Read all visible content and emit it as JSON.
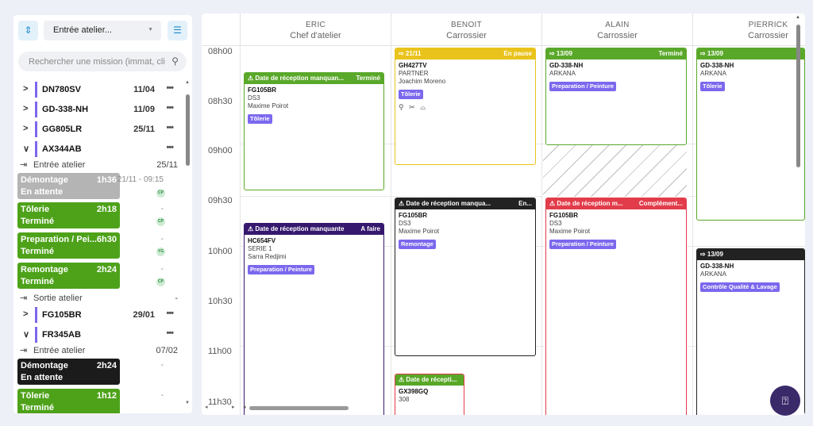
{
  "sidebar": {
    "sort_icon": "sort-arrows-icon",
    "select_value": "Entrée atelier...",
    "filter_icon": "filter-icon",
    "search_placeholder": "Rechercher une mission (immat, cli",
    "vehicles": [
      {
        "plate": "DN780SV",
        "date": "11/04",
        "expanded": false
      },
      {
        "plate": "GD-338-NH",
        "date": "11/09",
        "expanded": false
      },
      {
        "plate": "GG805LR",
        "date": "25/11",
        "expanded": false
      },
      {
        "plate": "AX344AB",
        "date": "",
        "expanded": true,
        "entry_label": "Entrée atelier",
        "entry_value": "25/11",
        "steps": [
          {
            "name": "Démontage",
            "duration": "1h36",
            "status": "En attente",
            "date": "21/11 - 09:15",
            "badge": "CP",
            "color": "grey"
          },
          {
            "name": "Tôlerie",
            "duration": "2h18",
            "status": "Terminé",
            "date": "-",
            "badge": "CP",
            "color": "green"
          },
          {
            "name": "Preparation / Pei...",
            "duration": "6h30",
            "status": "Terminé",
            "date": "-",
            "badge": "YG",
            "color": "green"
          },
          {
            "name": "Remontage",
            "duration": "2h24",
            "status": "Terminé",
            "date": "-",
            "badge": "CP",
            "color": "green"
          }
        ],
        "exit_label": "Sortie atelier",
        "exit_value": "-"
      },
      {
        "plate": "FG105BR",
        "date": "29/01",
        "expanded": false
      },
      {
        "plate": "FR345AB",
        "date": "",
        "expanded": true,
        "entry_label": "Entrée atelier",
        "entry_value": "07/02",
        "steps": [
          {
            "name": "Démontage",
            "duration": "2h24",
            "status": "En attente",
            "date": "-",
            "color": "black"
          },
          {
            "name": "Tôlerie",
            "duration": "1h12",
            "status": "Terminé",
            "date": "-",
            "color": "green"
          }
        ]
      }
    ]
  },
  "planning": {
    "columns": [
      {
        "name": "ERIC",
        "role": "Chef d'atelier"
      },
      {
        "name": "BENOIT",
        "role": "Carrossier"
      },
      {
        "name": "ALAIN",
        "role": "Carrossier"
      },
      {
        "name": "PIERRICK",
        "role": "Carrossier"
      }
    ],
    "times": [
      "08h00",
      "08h30",
      "09h00",
      "09h30",
      "10h00",
      "10h30",
      "11h00",
      "11h30"
    ],
    "cards": {
      "eric1": {
        "header": "⚠ Date de réception manquan...",
        "right": "Terminé",
        "plate": "FG105BR",
        "model": "DS3",
        "client": "Maxime Poirot",
        "tag": "Tôlerie"
      },
      "eric2": {
        "header": "⚠ Date de réception manquante",
        "right": "A faire",
        "plate": "HC654FV",
        "model": "SERIE 1",
        "client": "Sarra Redjimi",
        "tag": "Preparation / Peinture"
      },
      "benoit1": {
        "header": "⇨ 21/11",
        "right": "En pause",
        "plate": "GH427TV",
        "model": "PARTNER",
        "client": "Joachim Moreno",
        "tag": "Tôlerie",
        "tools": "⚲ ✂ ⌓"
      },
      "benoit2": {
        "header": "⚠ Date de réception manqua...",
        "right": "En...",
        "plate": "FG105BR",
        "model": "DS3",
        "client": "Maxime Poirot",
        "tag": "Remontage"
      },
      "benoit3": {
        "header": "⚠ Date de récepti...",
        "plate": "GX398GQ",
        "model": "308"
      },
      "alain1": {
        "header": "⇨ 13/09",
        "right": "Terminé",
        "plate": "GD-338-NH",
        "model": "ARKANA",
        "tag": "Preparation / Peinture"
      },
      "alain2": {
        "header": "⚠ Date de réception m...",
        "right": "Complément...",
        "plate": "FG105BR",
        "model": "DS3",
        "client": "Maxime Poirot",
        "tag": "Preparation / Peinture"
      },
      "pierrick1": {
        "header": "⇨ 13/09",
        "plate": "GD-338-NH",
        "model": "ARKANA",
        "tag": "Tôlerie"
      },
      "pierrick2": {
        "header": "⇨ 13/09",
        "plate": "GD-338-NH",
        "model": "ARKANA",
        "tag": "Contrôle Qualité & Lavage"
      }
    }
  },
  "help_icon": "help-chat-icon"
}
